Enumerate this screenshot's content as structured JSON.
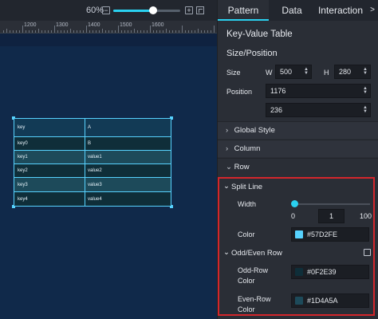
{
  "zoom": {
    "level": "60%",
    "percent": 60,
    "minus": "−",
    "plus": "+"
  },
  "ruler": {
    "ticks": [
      "1200",
      "1300",
      "1400",
      "1500",
      "1600"
    ]
  },
  "table": {
    "header": [
      "key",
      "A"
    ],
    "rows": [
      [
        "key0",
        "B"
      ],
      [
        "key1",
        "value1"
      ],
      [
        "key2",
        "value2"
      ],
      [
        "key3",
        "value3"
      ],
      [
        "key4",
        "value4"
      ]
    ]
  },
  "tabs": {
    "pattern": "Pattern",
    "data": "Data",
    "interaction": "Interaction",
    "more": ">"
  },
  "panel": {
    "title": "Key-Value Table",
    "size_position": "Size/Position",
    "size_label": "Size",
    "w_label": "W",
    "w_value": "500",
    "h_label": "H",
    "h_value": "280",
    "position_label": "Position",
    "x_value": "1176",
    "y_value": "236"
  },
  "sections": {
    "global_style": "Global Style",
    "column": "Column",
    "row": "Row",
    "split_line": "Split Line",
    "odd_even_row": "Odd/Even Row"
  },
  "split_line": {
    "width_label": "Width",
    "min": "0",
    "max": "100",
    "value": "1",
    "color_label": "Color",
    "color": "#57D2FE"
  },
  "odd_even": {
    "checked": false,
    "odd_label": "Odd-Row\nColor",
    "odd_label_1": "Odd-Row",
    "odd_label_2": "Color",
    "odd_color": "#0F2E39",
    "even_label_1": "Even-Row",
    "even_label_2": "Color",
    "even_color": "#1D4A5A"
  }
}
